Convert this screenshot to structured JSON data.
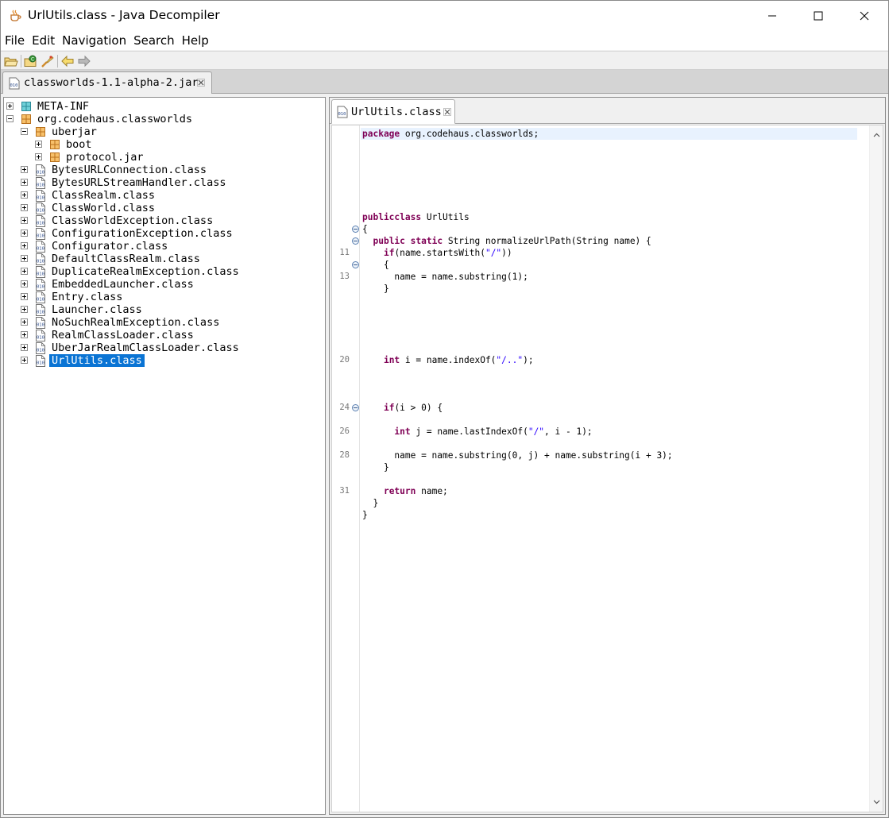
{
  "window": {
    "title": "UrlUtils.class - Java Decompiler"
  },
  "menu": [
    "File",
    "Edit",
    "Navigation",
    "Search",
    "Help"
  ],
  "toolbar": {
    "buttons": [
      "open-file-icon",
      "open-type-icon",
      "search-icon",
      "back-icon",
      "forward-icon"
    ]
  },
  "outer_tab": {
    "label": "classworlds-1.1-alpha-2.jar"
  },
  "tree": {
    "items": [
      {
        "label": "META-INF",
        "expander": "plus",
        "icon": "package-icon"
      },
      {
        "label": "org.codehaus.classworlds",
        "expander": "minus",
        "icon": "package-icon"
      },
      {
        "label": "uberjar",
        "expander": "minus",
        "icon": "package-icon"
      },
      {
        "label": "boot",
        "expander": "plus",
        "icon": "package-icon"
      },
      {
        "label": "protocol.jar",
        "expander": "plus",
        "icon": "package-icon"
      },
      {
        "label": "BytesURLConnection.class",
        "expander": "plus",
        "icon": "class-file-icon"
      },
      {
        "label": "BytesURLStreamHandler.class",
        "expander": "plus",
        "icon": "class-file-icon"
      },
      {
        "label": "ClassRealm.class",
        "expander": "plus",
        "icon": "class-file-icon"
      },
      {
        "label": "ClassWorld.class",
        "expander": "plus",
        "icon": "class-file-icon"
      },
      {
        "label": "ClassWorldException.class",
        "expander": "plus",
        "icon": "class-file-icon"
      },
      {
        "label": "ConfigurationException.class",
        "expander": "plus",
        "icon": "class-file-icon"
      },
      {
        "label": "Configurator.class",
        "expander": "plus",
        "icon": "class-file-icon"
      },
      {
        "label": "DefaultClassRealm.class",
        "expander": "plus",
        "icon": "class-file-icon"
      },
      {
        "label": "DuplicateRealmException.class",
        "expander": "plus",
        "icon": "class-file-icon"
      },
      {
        "label": "EmbeddedLauncher.class",
        "expander": "plus",
        "icon": "class-file-icon"
      },
      {
        "label": "Entry.class",
        "expander": "plus",
        "icon": "class-file-icon"
      },
      {
        "label": "Launcher.class",
        "expander": "plus",
        "icon": "class-file-icon"
      },
      {
        "label": "NoSuchRealmException.class",
        "expander": "plus",
        "icon": "class-file-icon"
      },
      {
        "label": "RealmClassLoader.class",
        "expander": "plus",
        "icon": "class-file-icon"
      },
      {
        "label": "UberJarRealmClassLoader.class",
        "expander": "plus",
        "icon": "class-file-icon"
      },
      {
        "label": "UrlUtils.class",
        "expander": "plus",
        "icon": "class-file-icon",
        "selected": true
      }
    ]
  },
  "editor": {
    "tab_label": "UrlUtils.class",
    "lines": [
      {
        "num": "",
        "fold": false,
        "tokens": [
          [
            "kw",
            "package"
          ],
          [
            "",
            "&nbsp;org.codehaus.classworlds;"
          ]
        ]
      },
      {
        "num": "",
        "fold": false,
        "tokens": [
          [
            "kw",
            "public"
          ],
          [
            "",
            ""
          ],
          [
            "kw",
            "class"
          ],
          [
            "",
            "UrlUtils"
          ]
        ]
      },
      {
        "num": "",
        "fold": true,
        "tokens": [
          [
            "",
            "{"
          ]
        ]
      },
      {
        "num": "",
        "fold": true,
        "tokens": [
          [
            "",
            "  "
          ],
          [
            "kw",
            "public"
          ],
          [
            "kw",
            "static"
          ],
          [
            "",
            "String normalizeUrlPath(String name) {"
          ]
        ]
      },
      {
        "num": "11",
        "fold": false,
        "tokens": [
          [
            "",
            "    "
          ],
          [
            "kw",
            "if"
          ],
          [
            "",
            "(name.startsWith("
          ],
          [
            "str",
            "\"/\""
          ],
          [
            "",
            "))"
          ]
        ]
      },
      {
        "num": "",
        "fold": true,
        "tokens": [
          [
            "",
            "    {"
          ]
        ]
      },
      {
        "num": "13",
        "fold": false,
        "tokens": [
          [
            "",
            "      name = name.substring(1);"
          ]
        ]
      },
      {
        "num": "",
        "fold": false,
        "tokens": [
          [
            "",
            "    }"
          ]
        ]
      },
      {
        "num": "20",
        "fold": false,
        "tokens": [
          [
            "",
            "    "
          ],
          [
            "kw",
            "int"
          ],
          [
            "",
            "i = name.indexOf("
          ],
          [
            "str",
            "\"/..\""
          ],
          [
            "",
            ");"
          ]
        ]
      },
      {
        "num": "24",
        "fold": true,
        "tokens": [
          [
            "",
            "    "
          ],
          [
            "kw",
            "if"
          ],
          [
            "",
            "(i > 0) {"
          ]
        ]
      },
      {
        "num": "26",
        "fold": false,
        "tokens": [
          [
            "",
            "      "
          ],
          [
            "kw",
            "int"
          ],
          [
            "",
            "j = name.lastIndexOf("
          ],
          [
            "str",
            "\"/\""
          ],
          [
            "",
            ", i - 1);"
          ]
        ]
      },
      {
        "num": "28",
        "fold": false,
        "tokens": [
          [
            "",
            "      name = name.substring(0, j) + name.substring(i + 3);"
          ]
        ]
      },
      {
        "num": "",
        "fold": false,
        "tokens": [
          [
            "",
            "    }"
          ]
        ]
      },
      {
        "num": "31",
        "fold": false,
        "tokens": [
          [
            "",
            "    "
          ],
          [
            "kw",
            "return"
          ],
          [
            "",
            "name;"
          ]
        ]
      },
      {
        "num": "",
        "fold": false,
        "tokens": [
          [
            "",
            "  }"
          ]
        ]
      },
      {
        "num": "",
        "fold": false,
        "tokens": [
          [
            "",
            "}"
          ]
        ]
      }
    ]
  }
}
